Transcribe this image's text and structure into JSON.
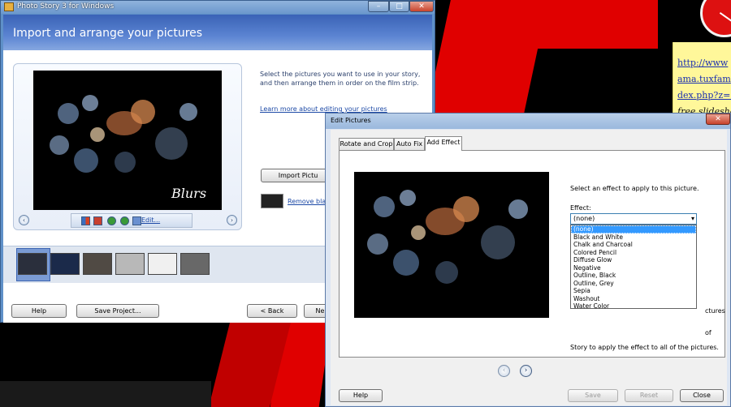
{
  "main_window": {
    "title": "Photo Story 3 for Windows",
    "heading": "Import and arrange your pictures",
    "instructions": "Select the pictures you want to use in your story, and then arrange them in order on the film strip.",
    "learn_link": "Learn more about editing your pictures",
    "import_button": "Import Pictu",
    "remove_black_label": "Remove black",
    "preview_caption": "Blurs",
    "edit_link": "Edit...",
    "buttons": {
      "help": "Help",
      "save_project": "Save Project...",
      "back": "< Back",
      "next": "Ne"
    },
    "window_controls": {
      "minimize": "–",
      "maximize": "□",
      "close": "✕"
    }
  },
  "desktop_note": {
    "lines": [
      "http://www",
      "ama.tuxfam",
      "dex.php?z=2",
      "free slidesho"
    ]
  },
  "edit_dialog": {
    "title": "Edit Pictures",
    "close": "✕",
    "tabs": [
      "Rotate and Crop",
      "Auto Fix",
      "Add Effect"
    ],
    "selected_tab": "Add Effect",
    "instruction": "Select an effect to apply to this picture.",
    "effect_label": "Effect:",
    "effect_value": "(none)",
    "effect_options": [
      "(none)",
      "Black and White",
      "Chalk and Charcoal",
      "Colored Pencil",
      "Diffuse Glow",
      "Negative",
      "Outline, Black",
      "Outline, Grey",
      "Sepia",
      "Washout",
      "Water Color"
    ],
    "partial_text_1": "ctures",
    "partial_text_2": "of",
    "partial_text_3": "Story to apply the effect to all of the pictures.",
    "buttons": {
      "help": "Help",
      "save": "Save",
      "reset": "Reset",
      "close": "Close"
    }
  },
  "colors": {
    "accent": "#3a62b6",
    "selection": "#3399ff",
    "desktop_red": "#e00000"
  },
  "icons": [
    "app-icon",
    "minimize-icon",
    "maximize-icon",
    "close-icon",
    "chevron-left-icon",
    "chevron-right-icon",
    "rotate-left-icon",
    "rotate-right-icon",
    "auto-correct-icon",
    "red-eye-icon",
    "edit-icon",
    "clock-icon"
  ]
}
